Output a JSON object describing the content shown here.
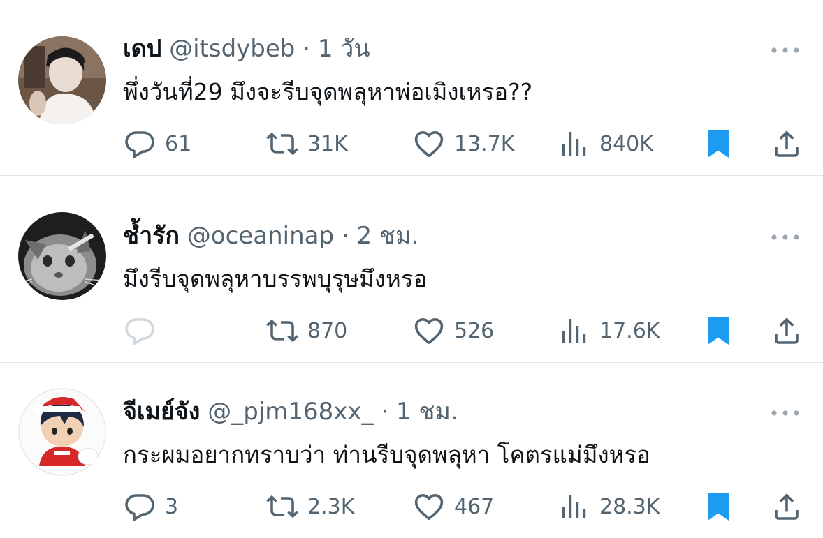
{
  "tweets": [
    {
      "name": "เดป",
      "handle": "@itsdybeb",
      "separator": "·",
      "time": "1 วัน",
      "text": "พึ่งวันที่29 มึงจะรีบจุดพลุหาพ่อเมิงเหรอ??",
      "replies": "61",
      "retweets": "31K",
      "likes": "13.7K",
      "views": "840K",
      "bookmarked": true,
      "reply_icon_muted": false
    },
    {
      "name": "ช้ำรัก",
      "handle": "@oceaninap",
      "separator": "·",
      "time": "2 ชม.",
      "text": "มึงรีบจุดพลุหาบรรพบุรุษมึงหรอ",
      "replies": "",
      "retweets": "870",
      "likes": "526",
      "views": "17.6K",
      "bookmarked": true,
      "reply_icon_muted": true
    },
    {
      "name": "จีเมย์จัง",
      "handle": "@_pjm168xx_",
      "separator": "·",
      "time": "1 ชม.",
      "text": "กระผมอยากทราบว่า ท่านรีบจุดพลุหา โคตรแม่มึงหรอ",
      "replies": "3",
      "retweets": "2.3K",
      "likes": "467",
      "views": "28.3K",
      "bookmarked": true,
      "reply_icon_muted": false
    }
  ],
  "icons": {
    "reply": "reply-icon",
    "retweet": "retweet-icon",
    "like": "heart-icon",
    "views": "views-icon",
    "bookmark": "bookmark-icon",
    "share": "share-icon",
    "more": "more-icon"
  },
  "colors": {
    "text": "#0f1419",
    "muted": "#536471",
    "muted_icon": "#cfd9de",
    "bookmark": "#1d9bf0",
    "divider": "#e3e6e9"
  }
}
